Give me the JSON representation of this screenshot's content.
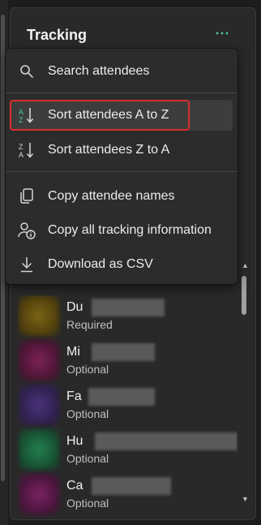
{
  "panel": {
    "title": "Tracking",
    "more_icon": "more-horizontal-icon",
    "accent_color": "#4ec9a6"
  },
  "menu": {
    "items": [
      {
        "label": "Search attendees",
        "icon": "search-icon"
      },
      {
        "label": "Sort attendees A to Z",
        "icon": "sort-ascending-icon",
        "selected": true
      },
      {
        "label": "Sort attendees Z to A",
        "icon": "sort-descending-icon"
      },
      {
        "label": "Copy attendee names",
        "icon": "copy-icon"
      },
      {
        "label": "Copy all tracking information",
        "icon": "people-info-icon"
      },
      {
        "label": "Download as CSV",
        "icon": "download-icon"
      }
    ]
  },
  "attendees": [
    {
      "name_visible": "Du",
      "status": "Required",
      "avatar_color": "#6b5a14"
    },
    {
      "name_visible": "Mi",
      "status": "Optional",
      "avatar_color": "#6a1f4a"
    },
    {
      "name_visible": "Fa",
      "status": "Optional",
      "avatar_color": "#3e2a66"
    },
    {
      "name_visible": "Hu",
      "status": "Optional",
      "avatar_color": "#1f6b42"
    },
    {
      "name_visible": "Ca",
      "status": "Optional",
      "avatar_color": "#6a1f52"
    }
  ]
}
